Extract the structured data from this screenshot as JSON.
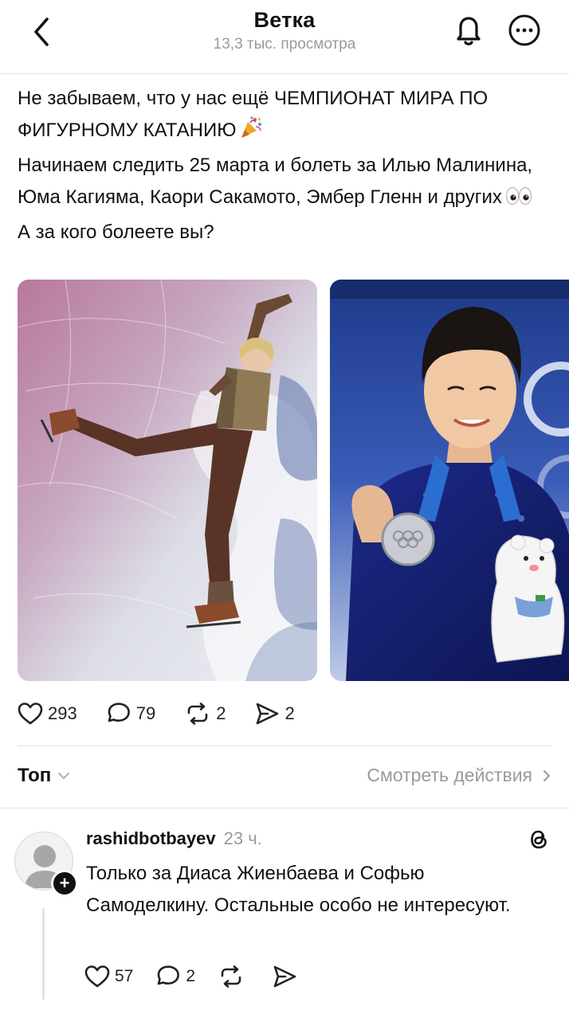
{
  "header": {
    "title": "Ветка",
    "views": "13,3 тыс. просмотра"
  },
  "post": {
    "line1": "Не забываем, что у нас ещё ЧЕМПИОНАТ МИРА ПО ФИГУРНОМУ КАТАНИЮ",
    "line2": "Начинаем следить 25 марта и болеть за Илью Малинина, Юма Кагияма, Каори Сакамото, Эмбер Гленн и других",
    "line3": "А за кого болеете вы?",
    "emoji1": "party-popper-icon",
    "emoji2": "eyes-icon",
    "stats": {
      "likes": "293",
      "comments": "79",
      "reposts": "2",
      "shares": "2"
    }
  },
  "sort": {
    "label": "Топ",
    "view_actions": "Смотреть действия"
  },
  "comment": {
    "username": "rashidbotbayev",
    "time": "23 ч.",
    "text": "Только за Диаса Жиенбаева и Софью Самоделкину. Остальные особо не интересуют.",
    "stats": {
      "likes": "57",
      "comments": "2"
    }
  },
  "colors": {
    "muted": "#9a9a9a",
    "text": "#111111",
    "divider": "#e4e4e4"
  }
}
